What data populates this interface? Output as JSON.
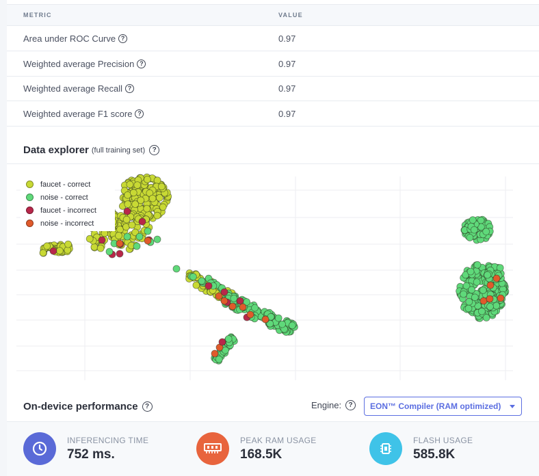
{
  "metrics_table": {
    "col_metric": "METRIC",
    "col_value": "VALUE",
    "rows": [
      {
        "label": "Area under ROC Curve",
        "value": "0.97"
      },
      {
        "label": "Weighted average Precision",
        "value": "0.97"
      },
      {
        "label": "Weighted average Recall",
        "value": "0.97"
      },
      {
        "label": "Weighted average F1 score",
        "value": "0.97"
      }
    ]
  },
  "data_explorer": {
    "title": "Data explorer",
    "subtitle": "(full training set)",
    "legend": [
      {
        "label": "faucet - correct",
        "color": "#c8d934"
      },
      {
        "label": "noise - correct",
        "color": "#5fd97a"
      },
      {
        "label": "faucet - incorrect",
        "color": "#b8274a"
      },
      {
        "label": "noise - incorrect",
        "color": "#e05a2b"
      }
    ]
  },
  "performance": {
    "title": "On-device performance",
    "engine_label": "Engine:",
    "engine_value": "EON™ Compiler (RAM optimized)",
    "stats": [
      {
        "label": "INFERENCING TIME",
        "value": "752 ms.",
        "icon": "clock-icon",
        "color": "#5a6ad7"
      },
      {
        "label": "PEAK RAM USAGE",
        "value": "168.5K",
        "icon": "memory-icon",
        "color": "#e8643d"
      },
      {
        "label": "FLASH USAGE",
        "value": "585.8K",
        "icon": "chip-icon",
        "color": "#3fc3e8"
      }
    ]
  },
  "help_glyph": "?"
}
